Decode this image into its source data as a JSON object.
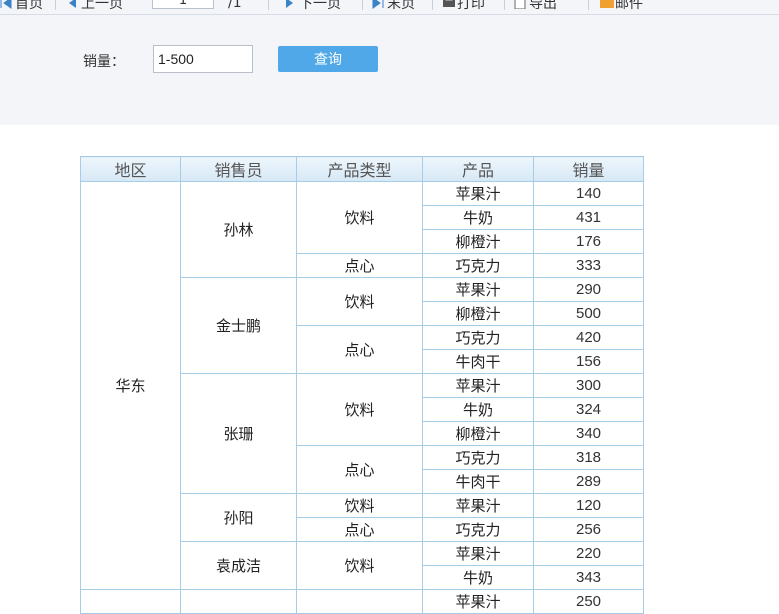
{
  "toolbar": {
    "first": "首页",
    "prev": "上一页",
    "page_value": "1",
    "total_pages": "/1",
    "next": "下一页",
    "last": "末页",
    "print": "打印",
    "export": "导出",
    "email": "邮件"
  },
  "query": {
    "sales_label": "销量：",
    "sales_value": "1-500",
    "submit_label": "查询"
  },
  "table": {
    "headers": [
      "地区",
      "销售员",
      "产品类型",
      "产品",
      "销量"
    ],
    "region": "华东",
    "salespeople": [
      {
        "name": "孙林",
        "types": [
          {
            "type": "饮料",
            "items": [
              [
                "苹果汁",
                "140"
              ],
              [
                "牛奶",
                "431"
              ],
              [
                "柳橙汁",
                "176"
              ]
            ]
          },
          {
            "type": "点心",
            "items": [
              [
                "巧克力",
                "333"
              ]
            ]
          }
        ]
      },
      {
        "name": "金士鹏",
        "types": [
          {
            "type": "饮料",
            "items": [
              [
                "苹果汁",
                "290"
              ],
              [
                "柳橙汁",
                "500"
              ]
            ]
          },
          {
            "type": "点心",
            "items": [
              [
                "巧克力",
                "420"
              ],
              [
                "牛肉干",
                "156"
              ]
            ]
          }
        ]
      },
      {
        "name": "张珊",
        "types": [
          {
            "type": "饮料",
            "items": [
              [
                "苹果汁",
                "300"
              ],
              [
                "牛奶",
                "324"
              ],
              [
                "柳橙汁",
                "340"
              ]
            ]
          },
          {
            "type": "点心",
            "items": [
              [
                "巧克力",
                "318"
              ],
              [
                "牛肉干",
                "289"
              ]
            ]
          }
        ]
      },
      {
        "name": "孙阳",
        "types": [
          {
            "type": "饮料",
            "items": [
              [
                "苹果汁",
                "120"
              ]
            ]
          },
          {
            "type": "点心",
            "items": [
              [
                "巧克力",
                "256"
              ]
            ]
          }
        ]
      },
      {
        "name": "袁成洁",
        "types": [
          {
            "type": "饮料",
            "items": [
              [
                "苹果汁",
                "220"
              ],
              [
                "牛奶",
                "343"
              ]
            ]
          }
        ]
      }
    ],
    "next_group_first_row": [
      "苹果汁",
      "250"
    ]
  }
}
